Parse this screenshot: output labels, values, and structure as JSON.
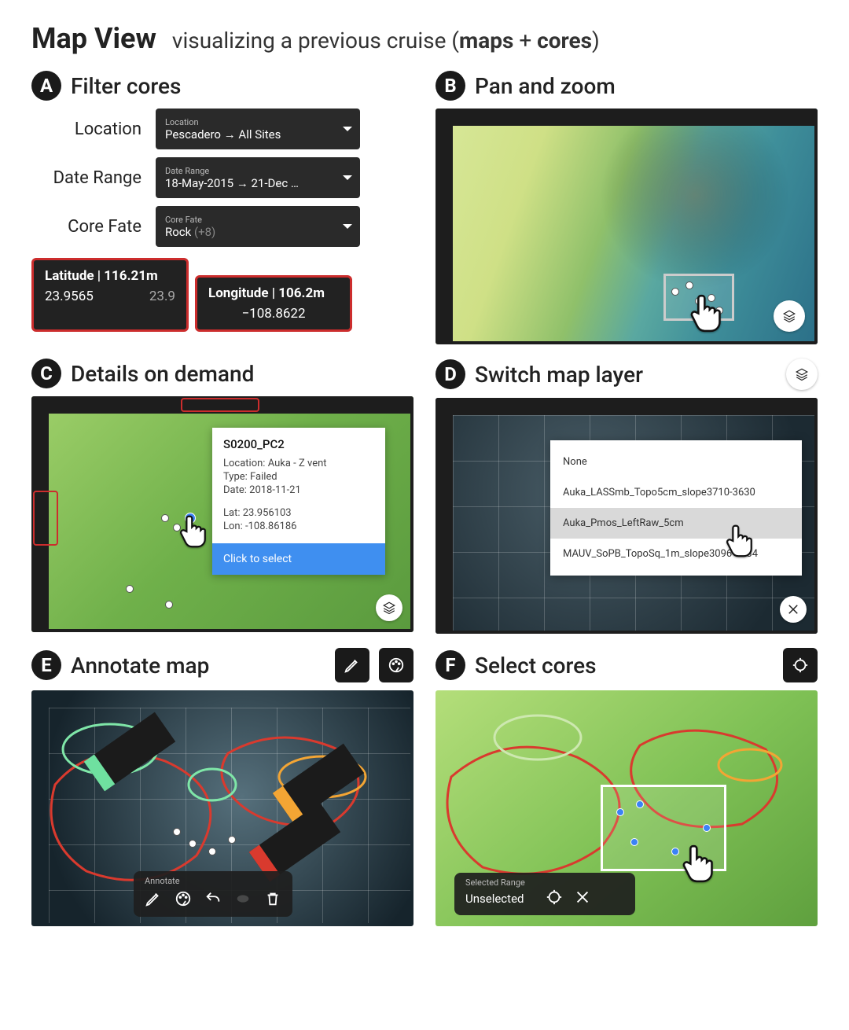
{
  "header": {
    "title": "Map View",
    "subtitle_pre": "visualizing a previous cruise (",
    "subtitle_bold1": "maps",
    "subtitle_mid": " + ",
    "subtitle_bold2": "cores",
    "subtitle_post": ")"
  },
  "panelA": {
    "badge": "A",
    "title": "Filter cores",
    "filters": {
      "location": {
        "label": "Location",
        "dd_label": "Location",
        "dd_value": "Pescadero → All Sites"
      },
      "daterange": {
        "label": "Date Range",
        "dd_label": "Date Range",
        "dd_value": "18-May-2015 → 21-Dec …"
      },
      "corefate": {
        "label": "Core Fate",
        "dd_label": "Core Fate",
        "dd_value": "Rock",
        "dd_suffix": " (+8)"
      }
    },
    "lat": {
      "title": "Latitude | 116.21m",
      "v1": "23.9565",
      "v2": "23.9"
    },
    "lon": {
      "title": "Longitude | 106.2m",
      "v1": "−108.8622",
      "v2": ""
    }
  },
  "panelB": {
    "badge": "B",
    "title": "Pan and zoom"
  },
  "panelC": {
    "badge": "C",
    "title": "Details on demand",
    "tooltip": {
      "name": "S0200_PC2",
      "location_label": "Location:",
      "location_value": "Auka - Z vent",
      "type_label": "Type:",
      "type_value": "Failed",
      "date_label": "Date:",
      "date_value": "2018-11-21",
      "lat_label": "Lat:",
      "lat_value": "23.956103",
      "lon_label": "Lon:",
      "lon_value": "-108.86186",
      "cta": "Click to select"
    }
  },
  "panelD": {
    "badge": "D",
    "title": "Switch map layer",
    "layers": {
      "none": "None",
      "l1": "Auka_LASSmb_Topo5cm_slope3710-3630",
      "l2": "Auka_Pmos_LeftRaw_5cm",
      "l3": "MAUV_SoPB_TopoSq_1m_slope3096-3334"
    }
  },
  "panelE": {
    "badge": "E",
    "title": "Annotate map",
    "bar_label": "Annotate"
  },
  "panelF": {
    "badge": "F",
    "title": "Select cores",
    "bar_label": "Selected Range",
    "bar_value": "Unselected"
  }
}
